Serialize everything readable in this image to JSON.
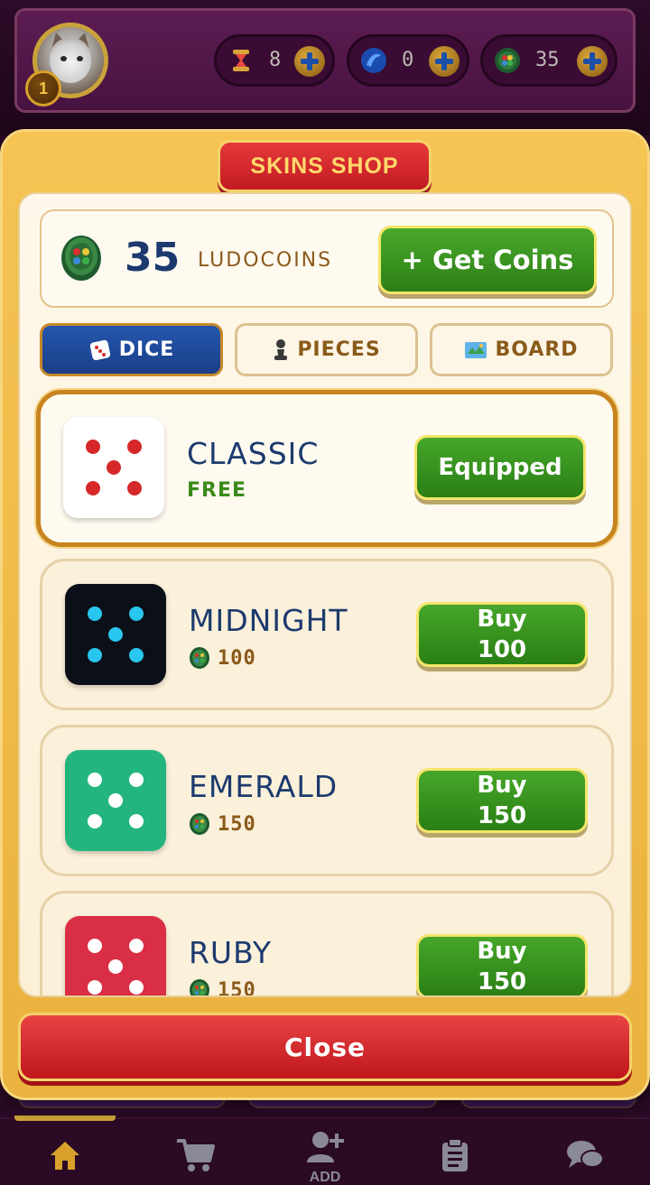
{
  "header": {
    "level": "1",
    "currencies": [
      {
        "icon": "hourglass-icon",
        "value": "8"
      },
      {
        "icon": "gem-icon",
        "value": "0"
      },
      {
        "icon": "ludocoin-icon",
        "value": "35"
      }
    ]
  },
  "shop": {
    "title": "SKINS SHOP",
    "wallet": {
      "amount": "35",
      "label": "LUDOCOINS",
      "get_coins_label": "+ Get Coins"
    },
    "tabs": [
      {
        "label": "DICE",
        "icon": "dice-icon",
        "active": true
      },
      {
        "label": "PIECES",
        "icon": "pawn-icon",
        "active": false
      },
      {
        "label": "BOARD",
        "icon": "map-icon",
        "active": false
      }
    ],
    "skins": [
      {
        "name": "CLASSIC",
        "price": "FREE",
        "button": "Equipped",
        "button_line2": "",
        "die_color": "#ffffff",
        "pip_color": "#d62828",
        "equipped": true
      },
      {
        "name": "MIDNIGHT",
        "price": "100",
        "button": "Buy",
        "button_line2": "100",
        "die_color": "#0b0f17",
        "pip_color": "#29c6ef",
        "equipped": false
      },
      {
        "name": "EMERALD",
        "price": "150",
        "button": "Buy",
        "button_line2": "150",
        "die_color": "#24b57f",
        "pip_color": "#ffffff",
        "equipped": false
      },
      {
        "name": "RUBY",
        "price": "150",
        "button": "Buy",
        "button_line2": "150",
        "die_color": "#d92e45",
        "pip_color": "#ffffff",
        "equipped": false
      }
    ],
    "close_label": "Close"
  },
  "bottom_nav": {
    "items": [
      {
        "icon": "home-icon",
        "active": true
      },
      {
        "icon": "cart-icon",
        "active": false
      },
      {
        "icon": "add-friend-icon",
        "label": "ADD",
        "active": false
      },
      {
        "icon": "clipboard-icon",
        "active": false
      },
      {
        "icon": "chat-icon",
        "active": false
      }
    ]
  },
  "colors": {
    "accent_gold": "#f5c453",
    "button_green": "#2c7f16",
    "close_red": "#c0161c",
    "tab_blue": "#1a3f88",
    "text_navy": "#1c3a6e"
  }
}
